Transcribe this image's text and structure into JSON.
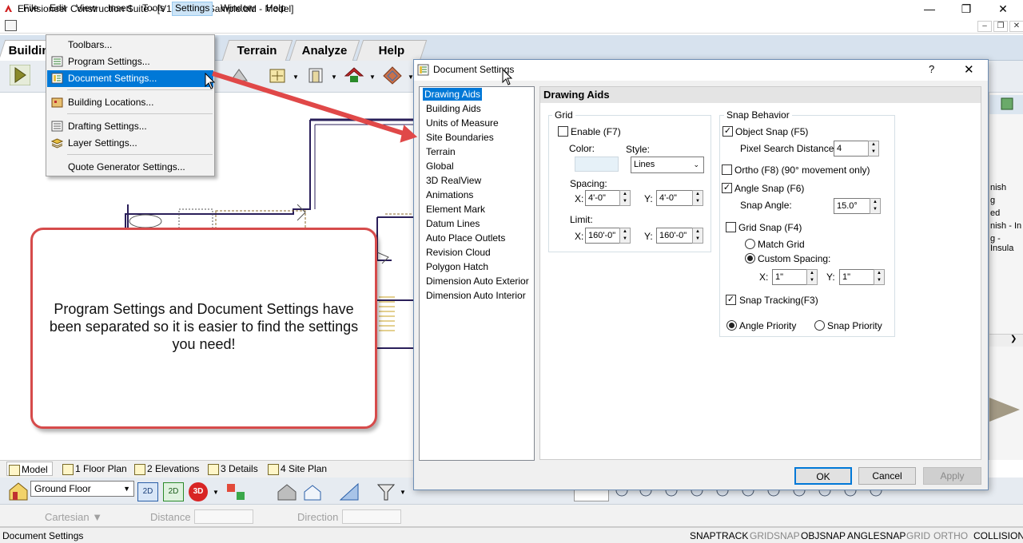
{
  "window": {
    "title": "Envisioneer Construction Suite - [V13 Model Sample.bld - Model]",
    "minimize": "—",
    "restore": "❐",
    "close": "✕"
  },
  "menubar": [
    "File",
    "Edit",
    "View",
    "Insert",
    "Tools",
    "Settings",
    "Window",
    "Help"
  ],
  "mdi_controls": [
    "–",
    "❐",
    "✕"
  ],
  "ribbon_tabs": [
    "Buildin",
    "Terrain",
    "Analyze",
    "Help"
  ],
  "settings_menu": {
    "items": [
      {
        "label": "Toolbars..."
      },
      {
        "label": "Program Settings..."
      },
      {
        "label": "Document Settings..."
      },
      {
        "label": "Building Locations..."
      },
      {
        "label": "Drafting Settings..."
      },
      {
        "label": "Layer Settings..."
      },
      {
        "label": "Quote Generator Settings..."
      }
    ]
  },
  "dialog": {
    "title": "Document Settings",
    "help": "?",
    "close": "✕",
    "nav": [
      "Drawing Aids",
      "Building Aids",
      "Units of Measure",
      "Site Boundaries",
      "Terrain",
      "Global",
      "3D RealView",
      "Animations",
      "Element Mark",
      "Datum Lines",
      "Auto Place Outlets",
      "Revision Cloud",
      "Polygon Hatch",
      "Dimension Auto Exterior",
      "Dimension Auto Interior"
    ],
    "section_title": "Drawing Aids",
    "grid": {
      "label": "Grid",
      "enable": "Enable (F7)",
      "color_label": "Color:",
      "style_label": "Style:",
      "style_value": "Lines",
      "spacing_label": "Spacing:",
      "x_label": "X:",
      "y_label": "Y:",
      "spacing_x": "4'-0\"",
      "spacing_y": "4'-0\"",
      "limit_label": "Limit:",
      "limit_x": "160'-0\"",
      "limit_y": "160'-0\""
    },
    "snap": {
      "label": "Snap Behavior",
      "object_snap": "Object Snap (F5)",
      "pixel_label": "Pixel Search Distance:",
      "pixel_value": "4",
      "ortho": "Ortho (F8) (90° movement only)",
      "angle_snap": "Angle Snap (F6)",
      "snap_angle_label": "Snap Angle:",
      "snap_angle_value": "15.0°",
      "grid_snap": "Grid Snap (F4)",
      "match_grid": "Match Grid",
      "custom_spacing": "Custom Spacing:",
      "x_label": "X:",
      "y_label": "Y:",
      "custom_x": "1\"",
      "custom_y": "1\"",
      "snap_tracking": "Snap Tracking(F3)",
      "angle_priority": "Angle Priority",
      "snap_priority": "Snap Priority"
    },
    "buttons": {
      "ok": "OK",
      "cancel": "Cancel",
      "apply": "Apply"
    }
  },
  "callout": {
    "text": "Program Settings and Document Settings have been separated so it is easier to find the settings you need!"
  },
  "sheet_tabs": [
    "Model",
    "1 Floor Plan",
    "2 Elevations",
    "3 Details",
    "4 Site Plan"
  ],
  "floor_select": "Ground Floor",
  "coord_bar": {
    "mode": "Cartesian ▼",
    "distance": "Distance",
    "direction": "Direction"
  },
  "status": {
    "left": "Document Settings",
    "indicators": [
      "SNAPTRACK",
      "GRIDSNAP",
      "OBJSNAP",
      "ANGLESNAP",
      "GRID",
      "ORTHO",
      "COLLISION"
    ]
  },
  "right_panel_snippets": [
    "nish",
    "g",
    "ed",
    "nish - In",
    "g - Insula"
  ],
  "colors": {
    "accent": "#0078d7",
    "callout_border": "#d64b4b",
    "arrow": "#e04848"
  }
}
